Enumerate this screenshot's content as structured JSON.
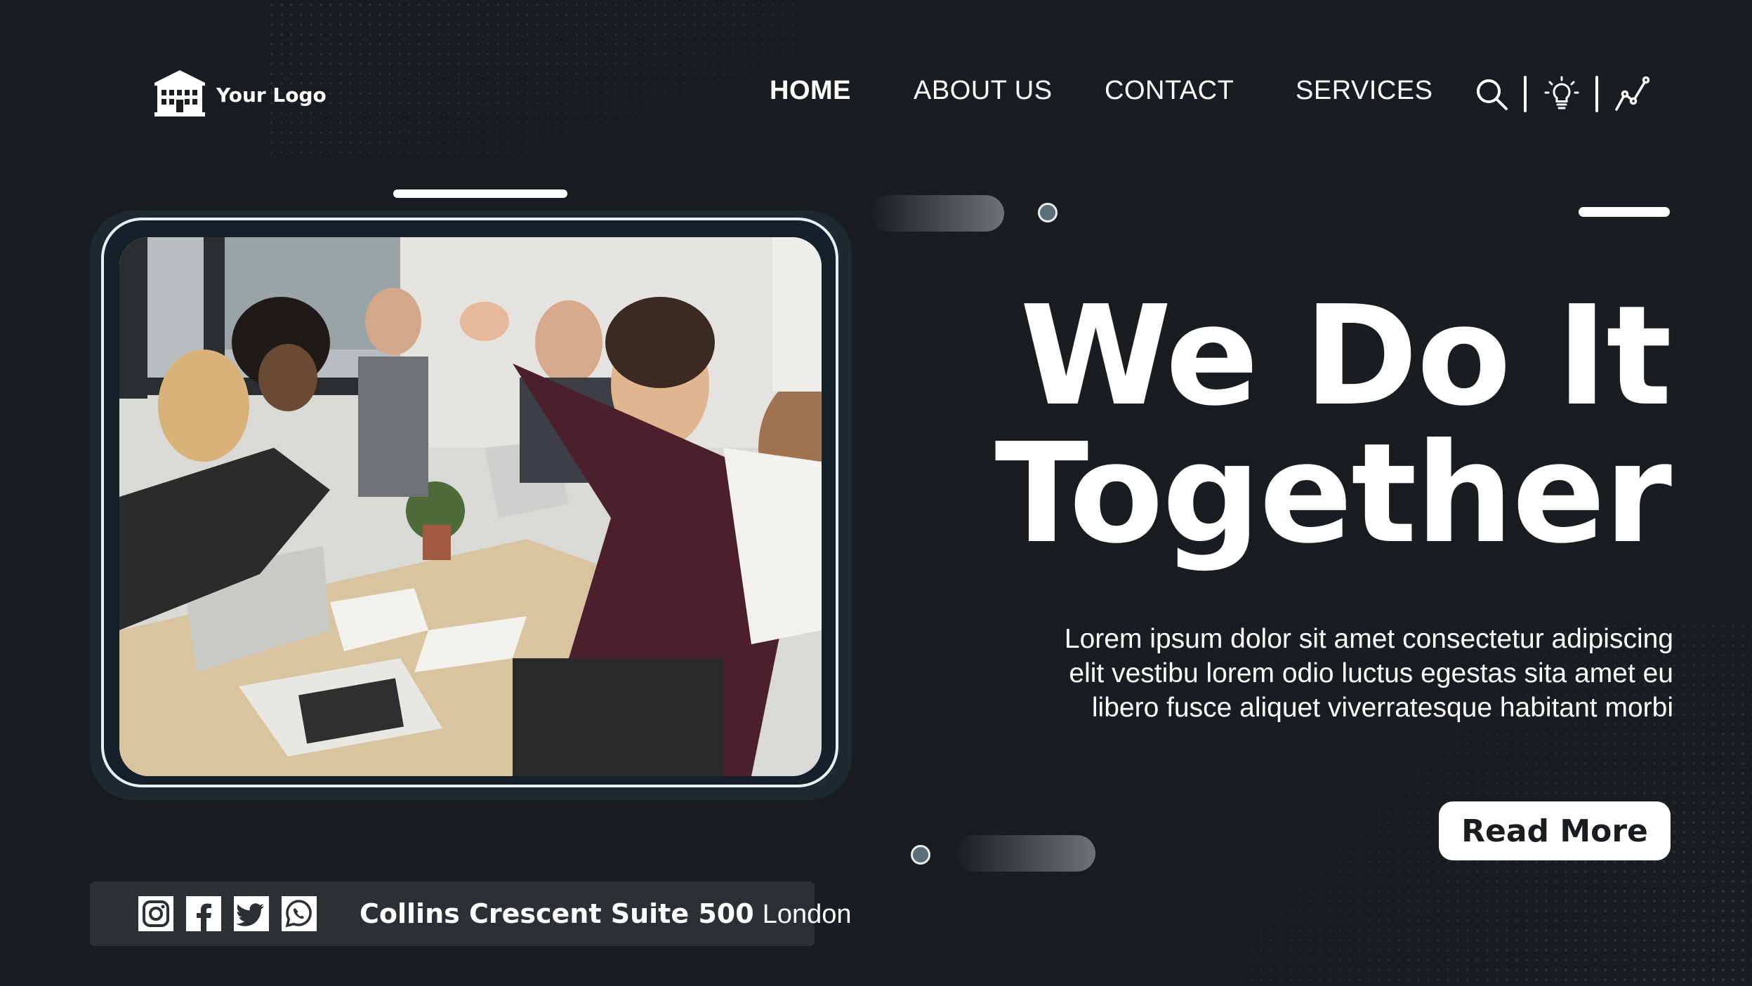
{
  "header": {
    "logo_text": "Your Logo",
    "nav": [
      {
        "label": "HOME",
        "active": true
      },
      {
        "label": "ABOUT US",
        "active": false
      },
      {
        "label": "CONTACT",
        "active": false
      },
      {
        "label": "SERVICES",
        "active": false
      }
    ],
    "icons": [
      "search-icon",
      "lightbulb-icon",
      "chart-line-icon"
    ]
  },
  "hero": {
    "title_line1": "We Do It",
    "title_line2": "Together",
    "body_line1": "Lorem ipsum dolor sit amet consectetur adipiscing",
    "body_line2": "elit vestibu lorem odio luctus egestas sita amet eu",
    "body_line3": "libero fusce aliquet viverratesque habitant morbi",
    "cta_label": "Read More"
  },
  "footer": {
    "social_icons": [
      "instagram-icon",
      "facebook-icon",
      "twitter-icon",
      "whatsapp-icon"
    ],
    "address_bold": "Collins Crescent Suite 500",
    "address_city": "London"
  },
  "colors": {
    "background": "#191d20",
    "text": "#ffffff",
    "social_strip": "#2b3034",
    "accent_dot": "#5c6f79"
  }
}
